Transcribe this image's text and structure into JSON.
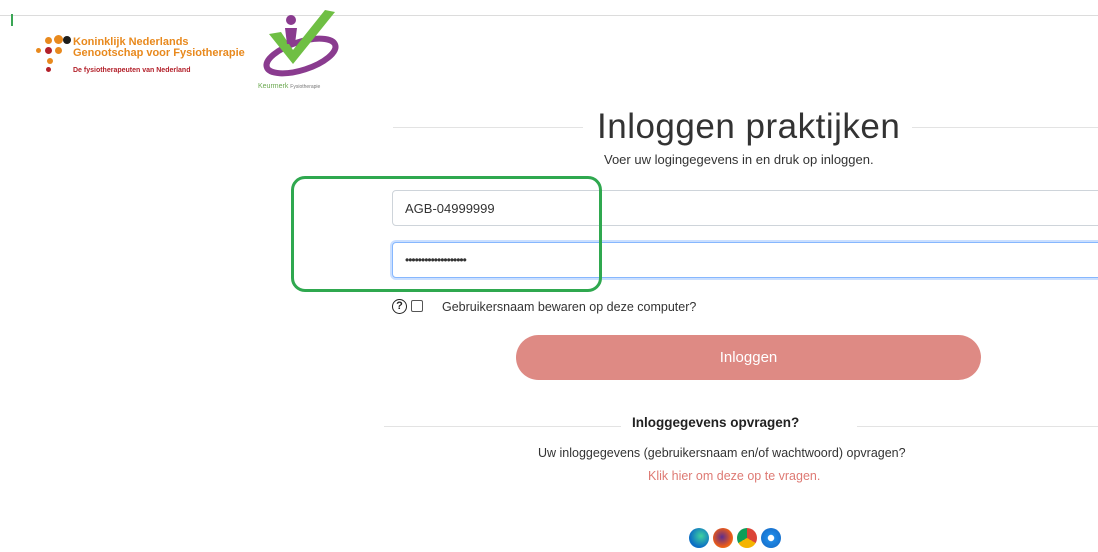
{
  "logos": {
    "kngf": {
      "line1": "Koninklijk Nederlands",
      "line2": "Genootschap voor Fysiotherapie",
      "tagline": "De fysiotherapeuten van Nederland"
    },
    "keurmerk": {
      "name": "Keurmerk",
      "suffix": "Fysiotherapie"
    }
  },
  "login": {
    "title": "Inloggen praktijken",
    "subtitle": "Voer uw logingegevens in en druk op inloggen.",
    "username_value": "AGB-04999999",
    "password_value": "•••••••••••••••••••",
    "help_icon_glyph": "?",
    "remember_label": "Gebruikersnaam bewaren op deze computer?",
    "button_label": "Inloggen"
  },
  "recover": {
    "title": "Inloggegevens opvragen?",
    "text": "Uw inloggegevens (gebruikersnaam en/of wachtwoord) opvragen?",
    "link": "Klik hier om deze op te vragen."
  },
  "browsers": [
    "edge-icon",
    "firefox-icon",
    "chrome-icon",
    "safari-icon"
  ],
  "colors": {
    "button": "#de8a84",
    "link": "#de7a74",
    "highlight": "#2fa84f",
    "kngf_orange": "#e8891d",
    "kngf_red": "#b3202a"
  }
}
